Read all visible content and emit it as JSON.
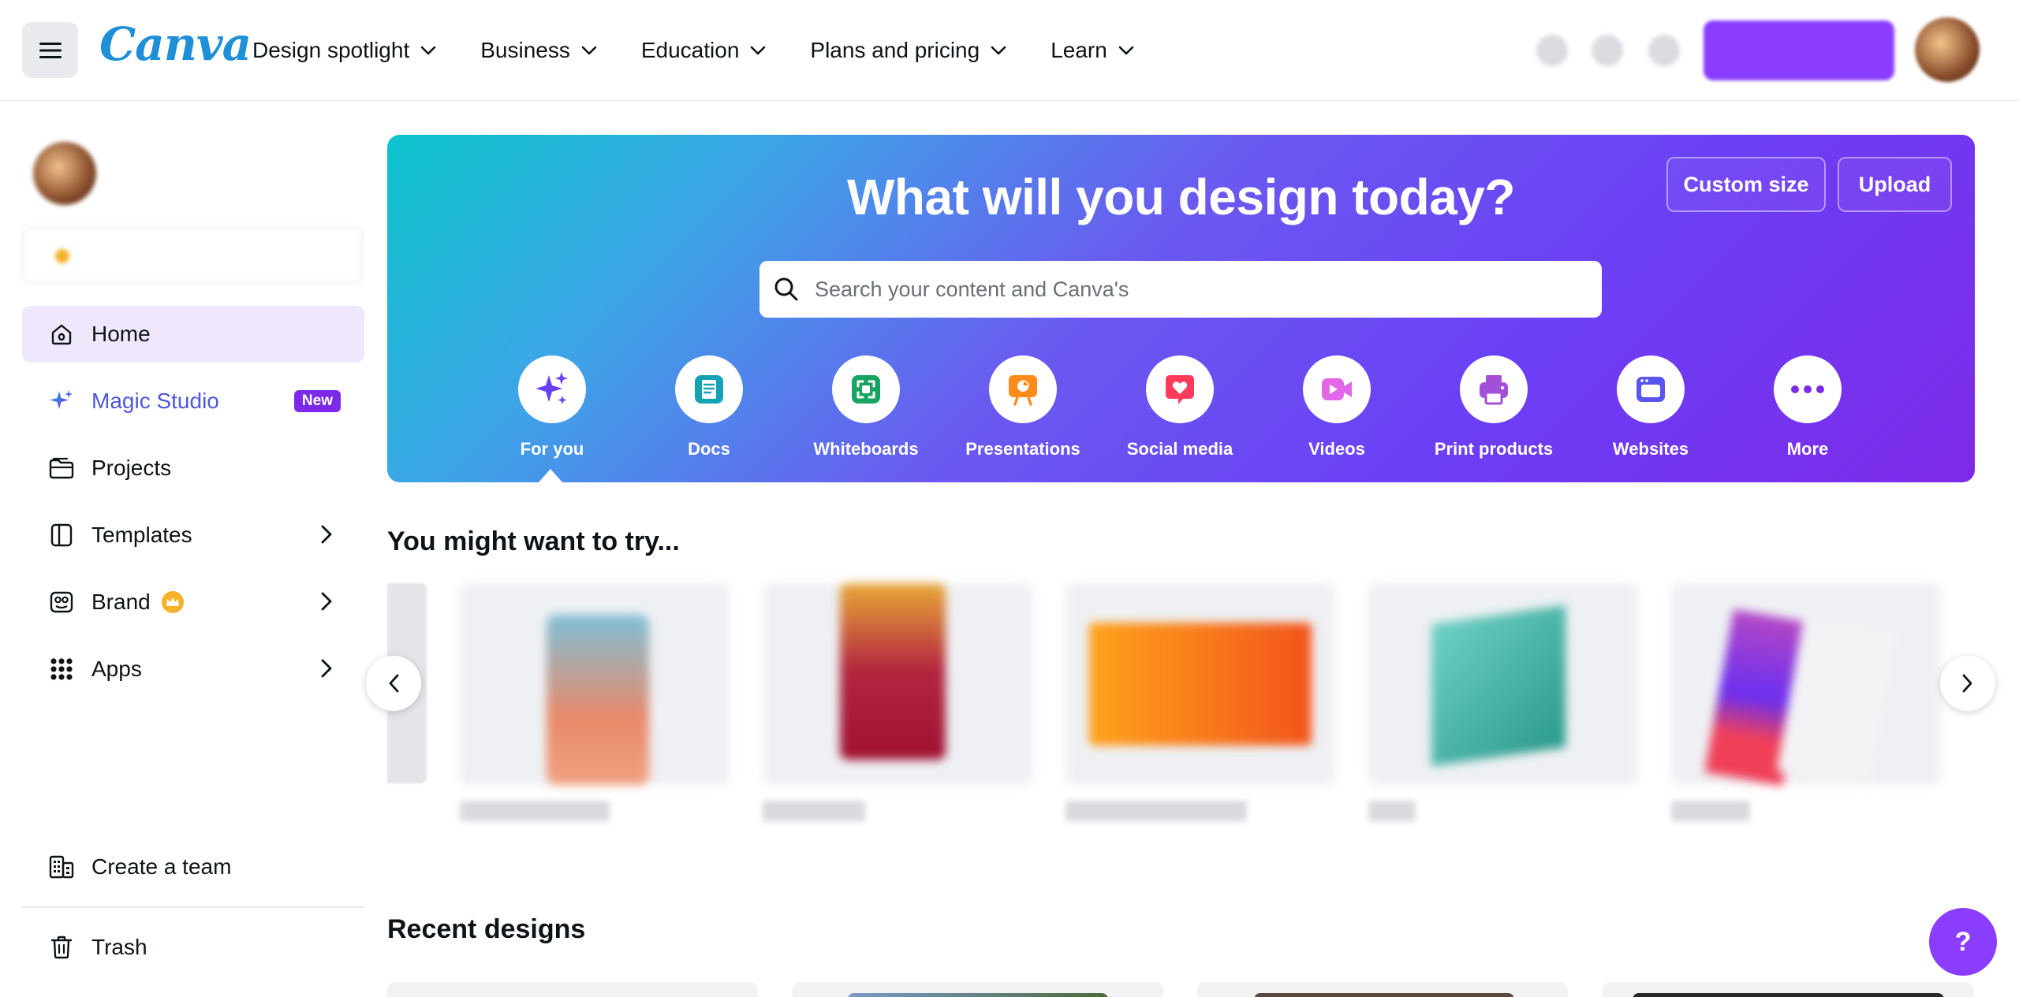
{
  "topbar": {
    "logo": "Canva",
    "nav": [
      {
        "label": "Design spotlight"
      },
      {
        "label": "Business"
      },
      {
        "label": "Education"
      },
      {
        "label": "Plans and pricing"
      },
      {
        "label": "Learn"
      }
    ]
  },
  "sidebar": {
    "items": [
      {
        "label": "Home",
        "icon": "home-icon",
        "active": true
      },
      {
        "label": "Magic Studio",
        "icon": "sparkle-icon",
        "badge": "New"
      },
      {
        "label": "Projects",
        "icon": "folder-icon"
      },
      {
        "label": "Templates",
        "icon": "template-icon"
      },
      {
        "label": "Brand",
        "icon": "brand-icon"
      },
      {
        "label": "Apps",
        "icon": "apps-grid-icon"
      }
    ],
    "bottom": [
      {
        "label": "Create a team",
        "icon": "building-icon"
      },
      {
        "label": "Trash",
        "icon": "trash-icon"
      }
    ]
  },
  "hero": {
    "title": "What will you design today?",
    "custom_size": "Custom size",
    "upload": "Upload",
    "search_placeholder": "Search your content and Canva's",
    "categories": [
      {
        "label": "For you",
        "icon": "sparkles-icon",
        "color": "#6b3ff5"
      },
      {
        "label": "Docs",
        "icon": "doc-icon",
        "color": "#13a3b5"
      },
      {
        "label": "Whiteboards",
        "icon": "whiteboard-icon",
        "color": "#1aa464"
      },
      {
        "label": "Presentations",
        "icon": "presentation-icon",
        "color": "#ff8c1a"
      },
      {
        "label": "Social media",
        "icon": "heart-icon",
        "color": "#ff3b5c"
      },
      {
        "label": "Videos",
        "icon": "video-icon",
        "color": "#e267e8"
      },
      {
        "label": "Print products",
        "icon": "printer-icon",
        "color": "#a34fd8"
      },
      {
        "label": "Websites",
        "icon": "website-icon",
        "color": "#5b55f0"
      },
      {
        "label": "More",
        "icon": "more-icon",
        "color": "#7d2ae8"
      }
    ]
  },
  "try_section": {
    "title": "You might want to try..."
  },
  "recent": {
    "title": "Recent designs"
  },
  "help": {
    "label": "?"
  },
  "colors": {
    "brand_purple": "#8b3dff",
    "logo_blue": "#1f8fd8"
  }
}
